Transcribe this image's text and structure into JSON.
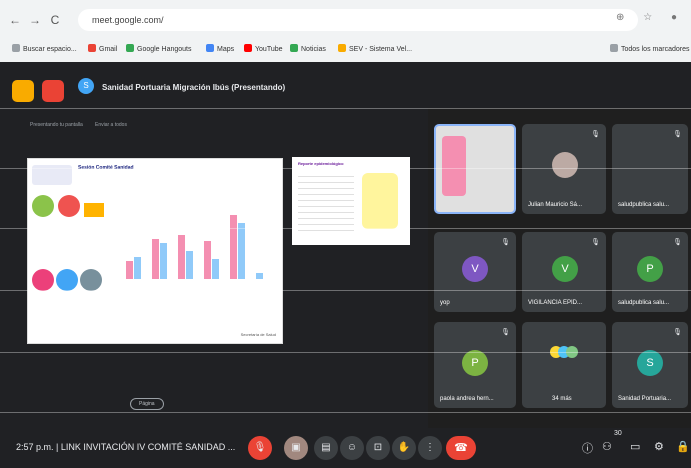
{
  "browser": {
    "nav": [
      "←",
      "→",
      "C"
    ],
    "url": "meet.google.com/",
    "right_icons": "⊕ ☆ ●",
    "bookmarks": [
      "Buscar espacio...",
      "Gmail",
      "Google Hangouts",
      "Maps",
      "YouTube",
      "Noticias",
      "SEV - Sistema Vel...",
      "Todos los marcadores"
    ]
  },
  "meet": {
    "presenter_title": "Sanidad Portuaria Migración Ibús (Presentando)",
    "presenter_initial": "S",
    "stage_hint_1": "Presentando tu pantalla",
    "stage_hint_2": "Enviar a todos",
    "slide_title": "Sesión Comité Sanidad",
    "slide_footer": "Secretaría de Salud",
    "mini_slide_title": "Reporte epidemiológico",
    "page_indicator": "Página",
    "participants": [
      {
        "name": "Julian Mauricio Sá...",
        "initial": "",
        "color": "#5f6368"
      },
      {
        "name": "saludpublica salu...",
        "initial": "",
        "color": "#3c4043"
      },
      {
        "name": "yop",
        "initial": "V",
        "color": "#7e57c2"
      },
      {
        "name": "VIGILANCIA EPID...",
        "initial": "V",
        "color": "#43a047"
      },
      {
        "name": "saludpublica salu...",
        "initial": "P",
        "color": "#43a047"
      },
      {
        "name": "paola andrea hern...",
        "initial": "P",
        "color": "#7cb342"
      },
      {
        "name": "34 más",
        "initial": "",
        "color": "#3c4043"
      },
      {
        "name": "Sanidad Portuaria...",
        "initial": "S",
        "color": "#26a69a"
      }
    ]
  },
  "bottom": {
    "time_and_title": "2:57 p.m.  |  LINK INVITACIÓN IV COMITÉ SANIDAD ...",
    "controls": [
      "mic-off",
      "camera-off",
      "captions",
      "emoji",
      "present",
      "raise-hand",
      "more"
    ],
    "right_count": "30"
  },
  "colors": {
    "end_call": "#ea4335",
    "accent": "#42a5f5"
  }
}
